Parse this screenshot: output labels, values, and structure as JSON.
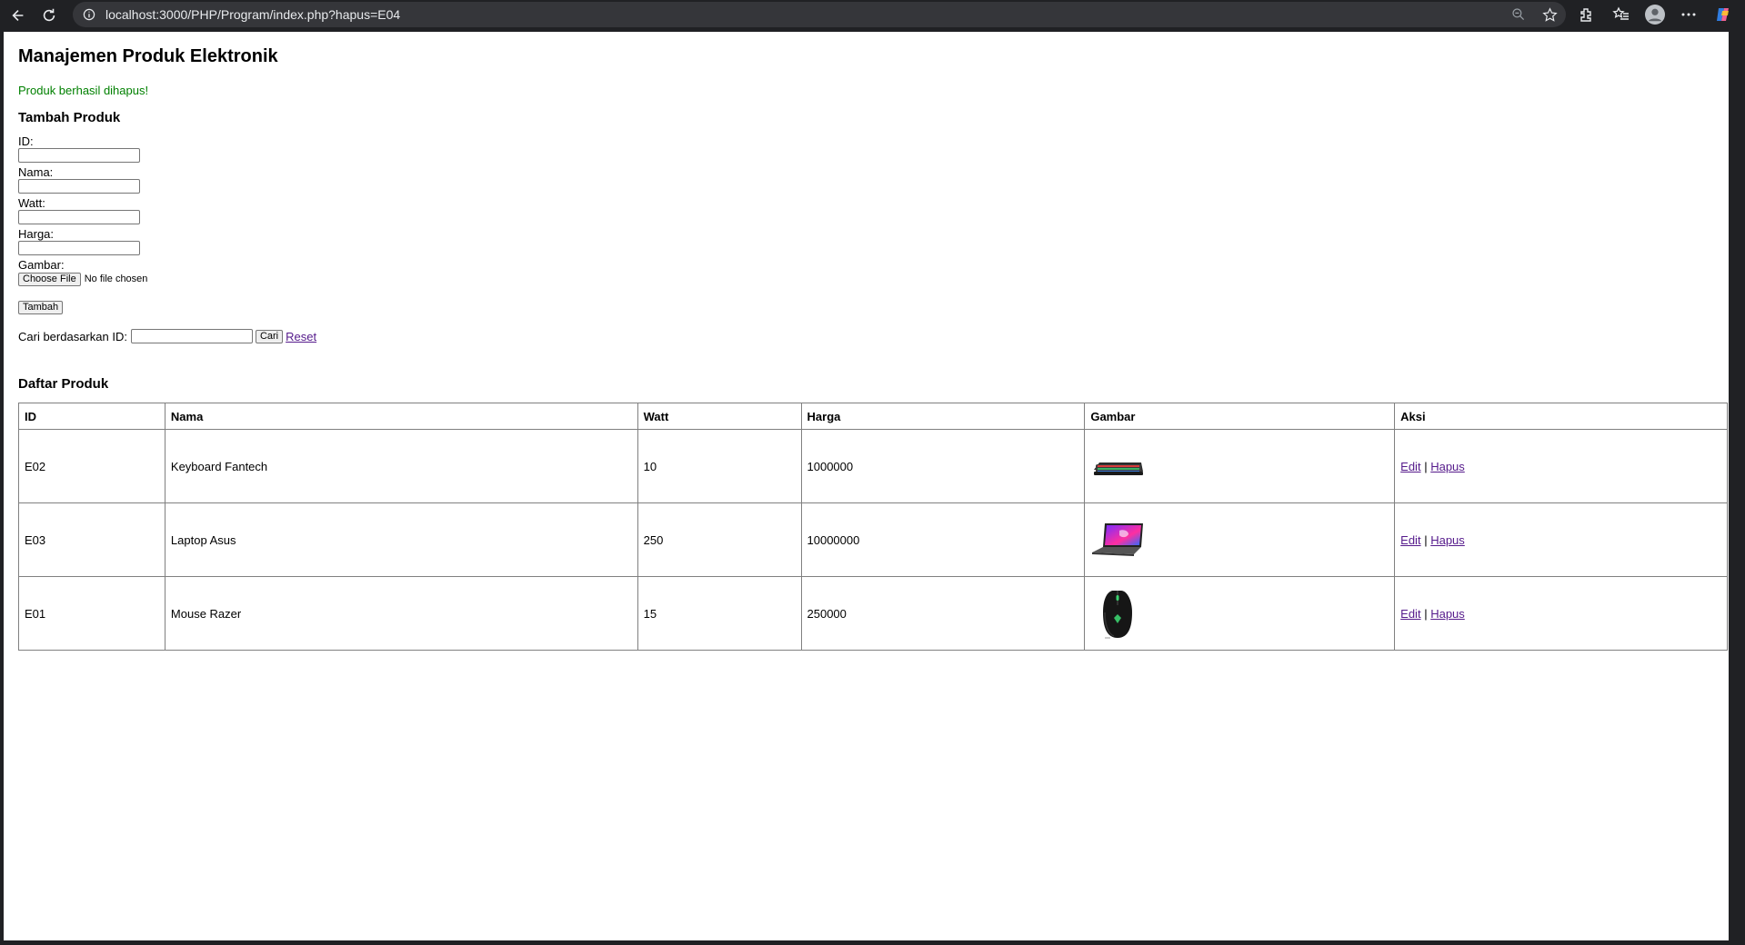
{
  "browser": {
    "url": "localhost:3000/PHP/Program/index.php?hapus=E04"
  },
  "page": {
    "title": "Manajemen Produk Elektronik",
    "message": "Produk berhasil dihapus!",
    "message_color": "#008000",
    "link_color": "#551a8b"
  },
  "form": {
    "heading": "Tambah Produk",
    "id_label": "ID:",
    "id_value": "",
    "nama_label": "Nama:",
    "nama_value": "",
    "watt_label": "Watt:",
    "watt_value": "",
    "harga_label": "Harga:",
    "harga_value": "",
    "gambar_label": "Gambar:",
    "file_button": "Choose File",
    "file_status": "No file chosen",
    "submit_label": "Tambah"
  },
  "search": {
    "label": "Cari berdasarkan ID:",
    "value": "",
    "button_label": "Cari",
    "reset_label": "Reset"
  },
  "list": {
    "heading": "Daftar Produk",
    "columns": [
      "ID",
      "Nama",
      "Watt",
      "Harga",
      "Gambar",
      "Aksi"
    ],
    "rows": [
      {
        "id": "E02",
        "nama": "Keyboard Fantech",
        "watt": "10",
        "harga": "1000000",
        "gambar": "keyboard-image",
        "edit": "Edit",
        "sep": "|",
        "hapus": "Hapus"
      },
      {
        "id": "E03",
        "nama": "Laptop Asus",
        "watt": "250",
        "harga": "10000000",
        "gambar": "laptop-image",
        "edit": "Edit",
        "sep": "|",
        "hapus": "Hapus"
      },
      {
        "id": "E01",
        "nama": "Mouse Razer",
        "watt": "15",
        "harga": "250000",
        "gambar": "mouse-image",
        "edit": "Edit",
        "sep": "|",
        "hapus": "Hapus"
      }
    ]
  }
}
